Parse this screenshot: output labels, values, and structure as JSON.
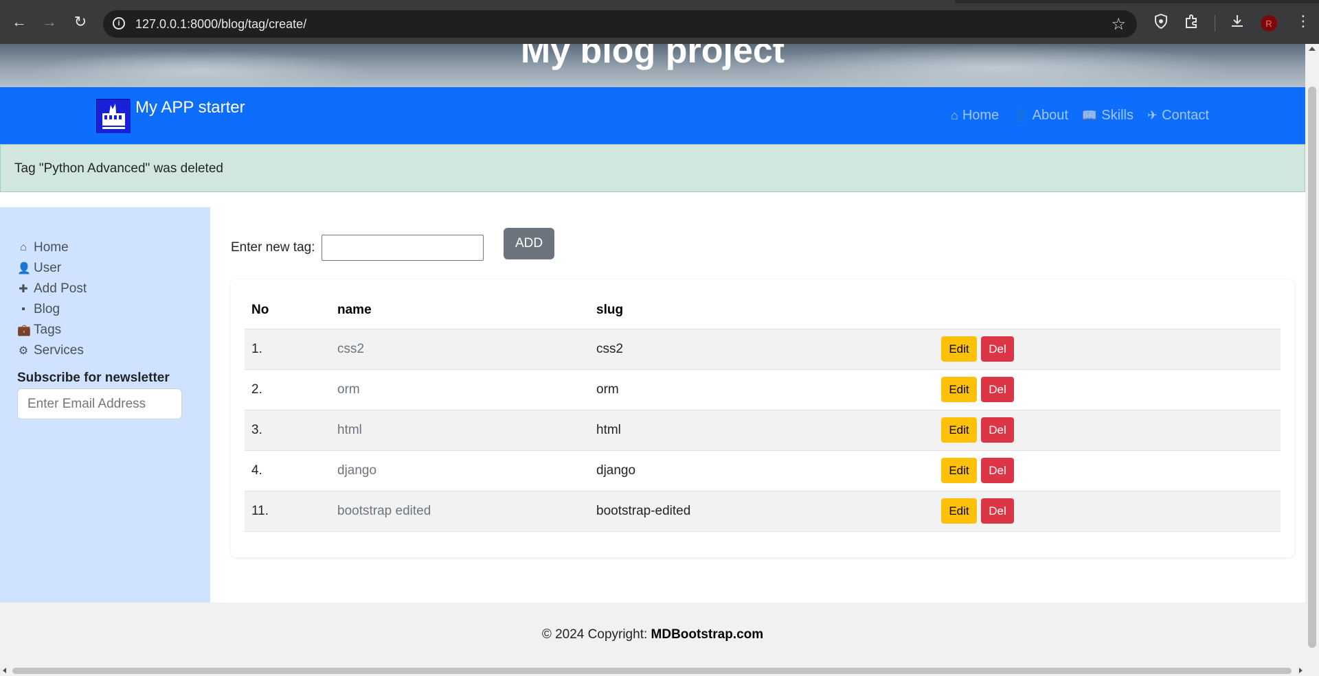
{
  "browser": {
    "url": "127.0.0.1:8000/blog/tag/create/",
    "back_icon": "←",
    "forward_icon": "→",
    "reload_icon": "↻",
    "star_icon": "☆",
    "kebab_icon": "⋮"
  },
  "hero": {
    "title": "My blog project"
  },
  "navbar": {
    "brand": "My APP starter",
    "links": [
      {
        "label": "Home",
        "icon": "⌂"
      },
      {
        "label": "About",
        "icon": "👤"
      },
      {
        "label": "Skills",
        "icon": "📖"
      },
      {
        "label": "Contact",
        "icon": "✈"
      }
    ]
  },
  "alert": {
    "message": "Tag \"Python Advanced\" was deleted"
  },
  "sidebar": {
    "items": [
      {
        "label": "Home",
        "icon": "⌂"
      },
      {
        "label": "User",
        "icon": "👤"
      },
      {
        "label": "Add Post",
        "icon": "✚"
      },
      {
        "label": "Blog",
        "icon": "▪"
      },
      {
        "label": "Tags",
        "icon": "💼"
      },
      {
        "label": "Services",
        "icon": "⚙"
      }
    ],
    "newsletter_title": "Subscribe for newsletter",
    "newsletter_placeholder": "Enter Email Address"
  },
  "add_form": {
    "label": "Enter new tag:",
    "value": "",
    "button": "ADD"
  },
  "table": {
    "headers": [
      "No",
      "name",
      "slug",
      ""
    ],
    "rows": [
      {
        "no": "1.",
        "name": "css2",
        "slug": "css2"
      },
      {
        "no": "2.",
        "name": "orm",
        "slug": "orm"
      },
      {
        "no": "3.",
        "name": "html",
        "slug": "html"
      },
      {
        "no": "4.",
        "name": "django",
        "slug": "django"
      },
      {
        "no": "11.",
        "name": "bootstrap edited",
        "slug": "bootstrap-edited"
      }
    ],
    "edit_label": "Edit",
    "del_label": "Del"
  },
  "footer": {
    "prefix": "© 2024 Copyright: ",
    "link": "MDBootstrap.com"
  },
  "colors": {
    "navbar": "#0d6efd",
    "sidebar": "#cfe2ff",
    "alert_bg": "#d1e7dd",
    "edit_btn": "#ffc107",
    "del_btn": "#dc3545"
  }
}
